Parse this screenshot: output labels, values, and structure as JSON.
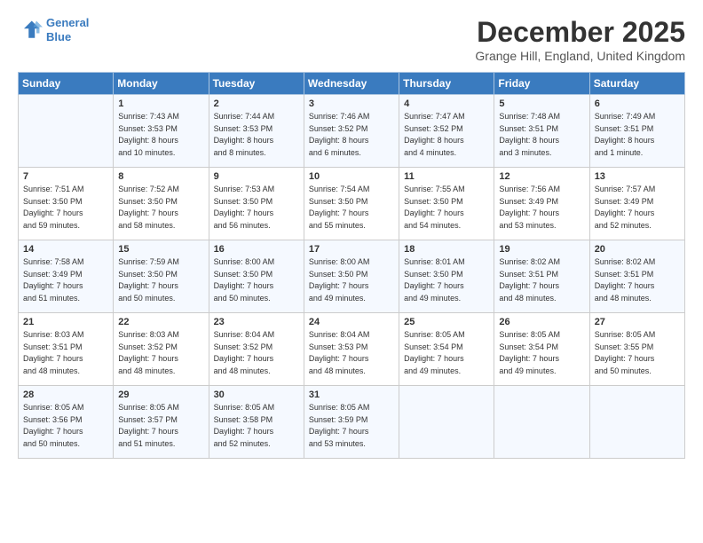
{
  "logo": {
    "line1": "General",
    "line2": "Blue"
  },
  "title": "December 2025",
  "subtitle": "Grange Hill, England, United Kingdom",
  "days_header": [
    "Sunday",
    "Monday",
    "Tuesday",
    "Wednesday",
    "Thursday",
    "Friday",
    "Saturday"
  ],
  "weeks": [
    [
      {
        "num": "",
        "info": ""
      },
      {
        "num": "1",
        "info": "Sunrise: 7:43 AM\nSunset: 3:53 PM\nDaylight: 8 hours\nand 10 minutes."
      },
      {
        "num": "2",
        "info": "Sunrise: 7:44 AM\nSunset: 3:53 PM\nDaylight: 8 hours\nand 8 minutes."
      },
      {
        "num": "3",
        "info": "Sunrise: 7:46 AM\nSunset: 3:52 PM\nDaylight: 8 hours\nand 6 minutes."
      },
      {
        "num": "4",
        "info": "Sunrise: 7:47 AM\nSunset: 3:52 PM\nDaylight: 8 hours\nand 4 minutes."
      },
      {
        "num": "5",
        "info": "Sunrise: 7:48 AM\nSunset: 3:51 PM\nDaylight: 8 hours\nand 3 minutes."
      },
      {
        "num": "6",
        "info": "Sunrise: 7:49 AM\nSunset: 3:51 PM\nDaylight: 8 hours\nand 1 minute."
      }
    ],
    [
      {
        "num": "7",
        "info": "Sunrise: 7:51 AM\nSunset: 3:50 PM\nDaylight: 7 hours\nand 59 minutes."
      },
      {
        "num": "8",
        "info": "Sunrise: 7:52 AM\nSunset: 3:50 PM\nDaylight: 7 hours\nand 58 minutes."
      },
      {
        "num": "9",
        "info": "Sunrise: 7:53 AM\nSunset: 3:50 PM\nDaylight: 7 hours\nand 56 minutes."
      },
      {
        "num": "10",
        "info": "Sunrise: 7:54 AM\nSunset: 3:50 PM\nDaylight: 7 hours\nand 55 minutes."
      },
      {
        "num": "11",
        "info": "Sunrise: 7:55 AM\nSunset: 3:50 PM\nDaylight: 7 hours\nand 54 minutes."
      },
      {
        "num": "12",
        "info": "Sunrise: 7:56 AM\nSunset: 3:49 PM\nDaylight: 7 hours\nand 53 minutes."
      },
      {
        "num": "13",
        "info": "Sunrise: 7:57 AM\nSunset: 3:49 PM\nDaylight: 7 hours\nand 52 minutes."
      }
    ],
    [
      {
        "num": "14",
        "info": "Sunrise: 7:58 AM\nSunset: 3:49 PM\nDaylight: 7 hours\nand 51 minutes."
      },
      {
        "num": "15",
        "info": "Sunrise: 7:59 AM\nSunset: 3:50 PM\nDaylight: 7 hours\nand 50 minutes."
      },
      {
        "num": "16",
        "info": "Sunrise: 8:00 AM\nSunset: 3:50 PM\nDaylight: 7 hours\nand 50 minutes."
      },
      {
        "num": "17",
        "info": "Sunrise: 8:00 AM\nSunset: 3:50 PM\nDaylight: 7 hours\nand 49 minutes."
      },
      {
        "num": "18",
        "info": "Sunrise: 8:01 AM\nSunset: 3:50 PM\nDaylight: 7 hours\nand 49 minutes."
      },
      {
        "num": "19",
        "info": "Sunrise: 8:02 AM\nSunset: 3:51 PM\nDaylight: 7 hours\nand 48 minutes."
      },
      {
        "num": "20",
        "info": "Sunrise: 8:02 AM\nSunset: 3:51 PM\nDaylight: 7 hours\nand 48 minutes."
      }
    ],
    [
      {
        "num": "21",
        "info": "Sunrise: 8:03 AM\nSunset: 3:51 PM\nDaylight: 7 hours\nand 48 minutes."
      },
      {
        "num": "22",
        "info": "Sunrise: 8:03 AM\nSunset: 3:52 PM\nDaylight: 7 hours\nand 48 minutes."
      },
      {
        "num": "23",
        "info": "Sunrise: 8:04 AM\nSunset: 3:52 PM\nDaylight: 7 hours\nand 48 minutes."
      },
      {
        "num": "24",
        "info": "Sunrise: 8:04 AM\nSunset: 3:53 PM\nDaylight: 7 hours\nand 48 minutes."
      },
      {
        "num": "25",
        "info": "Sunrise: 8:05 AM\nSunset: 3:54 PM\nDaylight: 7 hours\nand 49 minutes."
      },
      {
        "num": "26",
        "info": "Sunrise: 8:05 AM\nSunset: 3:54 PM\nDaylight: 7 hours\nand 49 minutes."
      },
      {
        "num": "27",
        "info": "Sunrise: 8:05 AM\nSunset: 3:55 PM\nDaylight: 7 hours\nand 50 minutes."
      }
    ],
    [
      {
        "num": "28",
        "info": "Sunrise: 8:05 AM\nSunset: 3:56 PM\nDaylight: 7 hours\nand 50 minutes."
      },
      {
        "num": "29",
        "info": "Sunrise: 8:05 AM\nSunset: 3:57 PM\nDaylight: 7 hours\nand 51 minutes."
      },
      {
        "num": "30",
        "info": "Sunrise: 8:05 AM\nSunset: 3:58 PM\nDaylight: 7 hours\nand 52 minutes."
      },
      {
        "num": "31",
        "info": "Sunrise: 8:05 AM\nSunset: 3:59 PM\nDaylight: 7 hours\nand 53 minutes."
      },
      {
        "num": "",
        "info": ""
      },
      {
        "num": "",
        "info": ""
      },
      {
        "num": "",
        "info": ""
      }
    ]
  ]
}
